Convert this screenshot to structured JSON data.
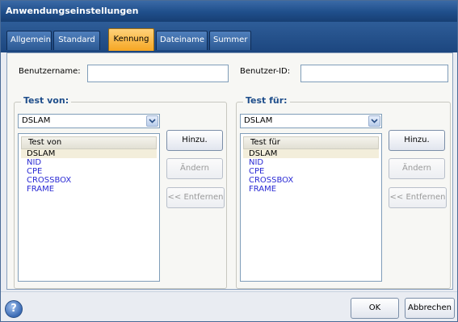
{
  "window": {
    "title": "Anwendungseinstellungen"
  },
  "tabs": [
    {
      "label": "Allgemein"
    },
    {
      "label": "Standard"
    },
    {
      "label": "Kennung"
    },
    {
      "label": "Dateiname"
    },
    {
      "label": "Summer"
    }
  ],
  "active_tab": "Kennung",
  "user": {
    "username_label": "Benutzername:",
    "username_value": "",
    "userid_label": "Benutzer-ID:",
    "userid_value": ""
  },
  "test_from": {
    "title": "Test von:",
    "selected": "DSLAM",
    "list_header": "Test von",
    "items": [
      "DSLAM",
      "NID",
      "CPE",
      "CROSSBOX",
      "FRAME"
    ],
    "selected_item": "DSLAM",
    "add_label": "Hinzu.",
    "edit_label": "Ändern",
    "remove_label": "<< Entfernen"
  },
  "test_for": {
    "title": "Test für:",
    "selected": "DSLAM",
    "list_header": "Test für",
    "items": [
      "DSLAM",
      "NID",
      "CPE",
      "CROSSBOX",
      "FRAME"
    ],
    "selected_item": "DSLAM",
    "add_label": "Hinzu.",
    "edit_label": "Ändern",
    "remove_label": "<< Entfernen"
  },
  "footer": {
    "help_icon": "question-mark",
    "ok_label": "OK",
    "cancel_label": "Abbrechen"
  },
  "colors": {
    "title_bar": "#1f4e8b",
    "active_tab": "#f5a623",
    "list_item_text": "#2a2ad4",
    "group_title": "#1f4e8b"
  }
}
